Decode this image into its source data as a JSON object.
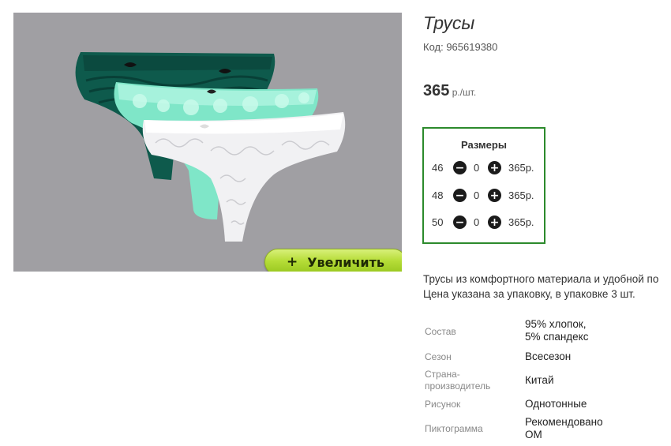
{
  "product": {
    "title": "Трусы",
    "code": "Код: 965619380",
    "price_amount": "365",
    "price_unit": " р./шт.",
    "image_alt": "Трусы"
  },
  "zoom_button": {
    "plus": "+",
    "label": "Увеличить"
  },
  "sizes": {
    "title": "Размеры",
    "rows": [
      {
        "size": "46",
        "qty": "0",
        "price": "365р."
      },
      {
        "size": "48",
        "qty": "0",
        "price": "365р."
      },
      {
        "size": "50",
        "qty": "0",
        "price": "365р."
      }
    ]
  },
  "description": {
    "line1": "Трусы из комфортного материала и удобной по",
    "line2": "Цена указана за упаковку, в упаковке 3 шт."
  },
  "properties": [
    {
      "key": "Состав",
      "value": "95% хлопок,\n5% спандекс"
    },
    {
      "key": "Сезон",
      "value": "Всесезон"
    },
    {
      "key": "Страна-производитель",
      "key_display_1": "Страна-",
      "key_display_2": "производитель",
      "value": "Китай"
    },
    {
      "key": "Рисунок",
      "value": "Однотонные"
    },
    {
      "key": "Пиктограмма",
      "value": "Рекомендовано\nОМ"
    }
  ],
  "colors": {
    "frame_border": "#2c8a2c",
    "zoom_button": "#b6dd38",
    "photo_bg": "#a09fa3"
  },
  "icons": {
    "decrease": "minus-circle-icon",
    "increase": "plus-circle-icon"
  }
}
